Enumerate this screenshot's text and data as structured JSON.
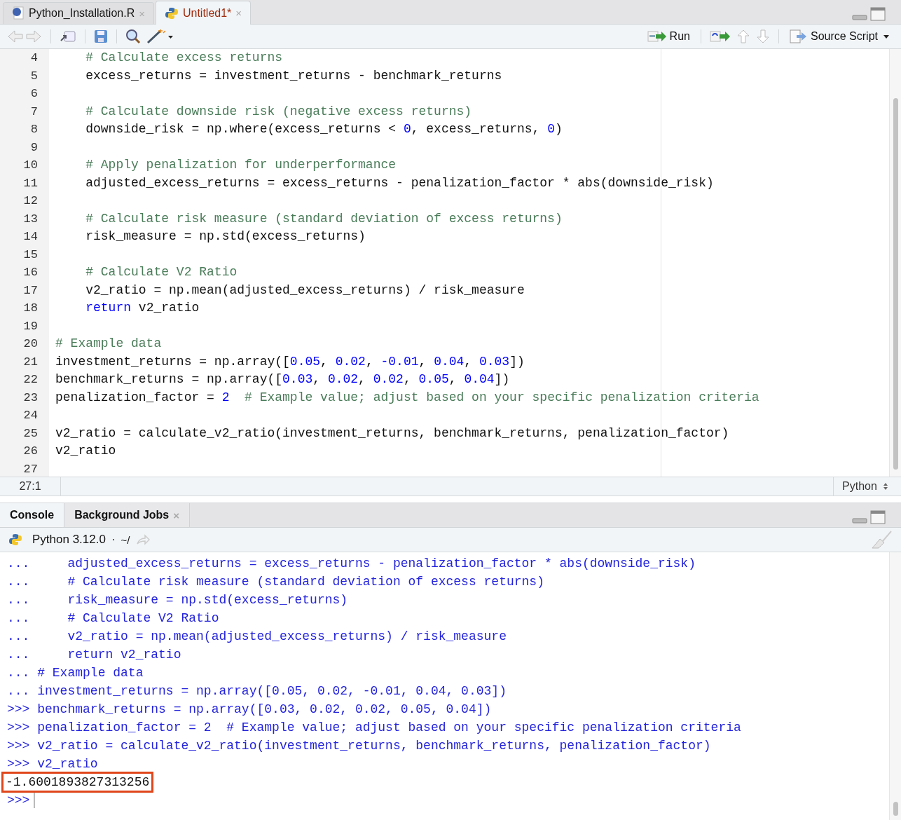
{
  "editor_tabs": [
    {
      "label": "Python_Installation.R",
      "kind": "r",
      "selected": false,
      "modified": false,
      "close": "×"
    },
    {
      "label": "Untitled1*",
      "kind": "python",
      "selected": true,
      "modified": true,
      "close": "×"
    }
  ],
  "toolbar": {
    "run_label": "Run",
    "source_label": "Source Script"
  },
  "editor_lines": [
    {
      "number": "4",
      "segments": [
        {
          "kind": "comment",
          "text": "    # Calculate excess returns"
        }
      ]
    },
    {
      "number": "5",
      "segments": [
        {
          "kind": "plain",
          "text": "    excess_returns = investment_returns - benchmark_returns"
        }
      ]
    },
    {
      "number": "6"
    },
    {
      "number": "7",
      "segments": [
        {
          "kind": "comment",
          "text": "    # Calculate downside risk (negative excess returns)"
        }
      ]
    },
    {
      "number": "8",
      "segments": [
        {
          "kind": "plain",
          "text": "    downside_risk = np.where(excess_returns < "
        },
        {
          "kind": "number",
          "text": "0"
        },
        {
          "kind": "plain",
          "text": ", excess_returns, "
        },
        {
          "kind": "number",
          "text": "0"
        },
        {
          "kind": "plain",
          "text": ")"
        }
      ]
    },
    {
      "number": "9"
    },
    {
      "number": "10",
      "segments": [
        {
          "kind": "comment",
          "text": "    # Apply penalization for underperformance"
        }
      ]
    },
    {
      "number": "11",
      "segments": [
        {
          "kind": "plain",
          "text": "    adjusted_excess_returns = excess_returns - penalization_factor * abs(downside_risk)"
        }
      ]
    },
    {
      "number": "12"
    },
    {
      "number": "13",
      "segments": [
        {
          "kind": "comment",
          "text": "    # Calculate risk measure (standard deviation of excess returns)"
        }
      ]
    },
    {
      "number": "14",
      "segments": [
        {
          "kind": "plain",
          "text": "    risk_measure = np.std(excess_returns)"
        }
      ]
    },
    {
      "number": "15"
    },
    {
      "number": "16",
      "segments": [
        {
          "kind": "comment",
          "text": "    # Calculate V2 Ratio"
        }
      ]
    },
    {
      "number": "17",
      "segments": [
        {
          "kind": "plain",
          "text": "    v2_ratio = np.mean(adjusted_excess_returns) / risk_measure"
        }
      ]
    },
    {
      "number": "18",
      "segments": [
        {
          "kind": "keyword",
          "text": "    return"
        },
        {
          "kind": "plain",
          "text": " v2_ratio"
        }
      ]
    },
    {
      "number": "19"
    },
    {
      "number": "20",
      "segments": [
        {
          "kind": "comment",
          "text": "# Example data"
        }
      ]
    },
    {
      "number": "21",
      "segments": [
        {
          "kind": "plain",
          "text": "investment_returns = np.array(["
        },
        {
          "kind": "number",
          "text": "0.05"
        },
        {
          "kind": "plain",
          "text": ", "
        },
        {
          "kind": "number",
          "text": "0.02"
        },
        {
          "kind": "plain",
          "text": ", "
        },
        {
          "kind": "number",
          "text": "-0.01"
        },
        {
          "kind": "plain",
          "text": ", "
        },
        {
          "kind": "number",
          "text": "0.04"
        },
        {
          "kind": "plain",
          "text": ", "
        },
        {
          "kind": "number",
          "text": "0.03"
        },
        {
          "kind": "plain",
          "text": "])"
        }
      ]
    },
    {
      "number": "22",
      "segments": [
        {
          "kind": "plain",
          "text": "benchmark_returns = np.array(["
        },
        {
          "kind": "number",
          "text": "0.03"
        },
        {
          "kind": "plain",
          "text": ", "
        },
        {
          "kind": "number",
          "text": "0.02"
        },
        {
          "kind": "plain",
          "text": ", "
        },
        {
          "kind": "number",
          "text": "0.02"
        },
        {
          "kind": "plain",
          "text": ", "
        },
        {
          "kind": "number",
          "text": "0.05"
        },
        {
          "kind": "plain",
          "text": ", "
        },
        {
          "kind": "number",
          "text": "0.04"
        },
        {
          "kind": "plain",
          "text": "])"
        }
      ]
    },
    {
      "number": "23",
      "segments": [
        {
          "kind": "plain",
          "text": "penalization_factor = "
        },
        {
          "kind": "number",
          "text": "2"
        },
        {
          "kind": "comment",
          "text": "  # Example value; adjust based on your specific penalization criteria"
        }
      ]
    },
    {
      "number": "24"
    },
    {
      "number": "25",
      "segments": [
        {
          "kind": "plain",
          "text": "v2_ratio = calculate_v2_ratio(investment_returns, benchmark_returns, penalization_factor)"
        }
      ]
    },
    {
      "number": "26",
      "segments": [
        {
          "kind": "plain",
          "text": "v2_ratio"
        }
      ]
    },
    {
      "number": "27"
    }
  ],
  "status_bar": {
    "position": "27:1",
    "language": "Python"
  },
  "console_tabs": [
    {
      "label": "Console",
      "selected": true
    },
    {
      "label": "Background Jobs",
      "selected": false,
      "close": "×"
    }
  ],
  "console_header": {
    "interpreter": "Python 3.12.0",
    "separator": "·",
    "path": "~/"
  },
  "console_lines": [
    {
      "kind": "input",
      "prompt": "...",
      "text": "    adjusted_excess_returns = excess_returns - penalization_factor * abs(downside_risk)"
    },
    {
      "kind": "input",
      "prompt": "...",
      "text": "    # Calculate risk measure (standard deviation of excess returns)"
    },
    {
      "kind": "input",
      "prompt": "...",
      "text": "    risk_measure = np.std(excess_returns)"
    },
    {
      "kind": "input",
      "prompt": "...",
      "text": "    # Calculate V2 Ratio"
    },
    {
      "kind": "input",
      "prompt": "...",
      "text": "    v2_ratio = np.mean(adjusted_excess_returns) / risk_measure"
    },
    {
      "kind": "input",
      "prompt": "...",
      "text": "    return v2_ratio"
    },
    {
      "kind": "input",
      "prompt": "...",
      "text": "# Example data"
    },
    {
      "kind": "input",
      "prompt": "...",
      "text": "investment_returns = np.array([0.05, 0.02, -0.01, 0.04, 0.03])"
    },
    {
      "kind": "input",
      "prompt": ">>>",
      "text": "benchmark_returns = np.array([0.03, 0.02, 0.02, 0.05, 0.04])"
    },
    {
      "kind": "input",
      "prompt": ">>>",
      "text": "penalization_factor = 2  # Example value; adjust based on your specific penalization criteria"
    },
    {
      "kind": "input",
      "prompt": ">>>",
      "text": "v2_ratio = calculate_v2_ratio(investment_returns, benchmark_returns, penalization_factor)"
    },
    {
      "kind": "input",
      "prompt": ">>>",
      "text": "v2_ratio"
    },
    {
      "kind": "output",
      "text": "-1.6001893827313256",
      "highlighted": true
    },
    {
      "kind": "prompt",
      "prompt": ">>>"
    }
  ]
}
